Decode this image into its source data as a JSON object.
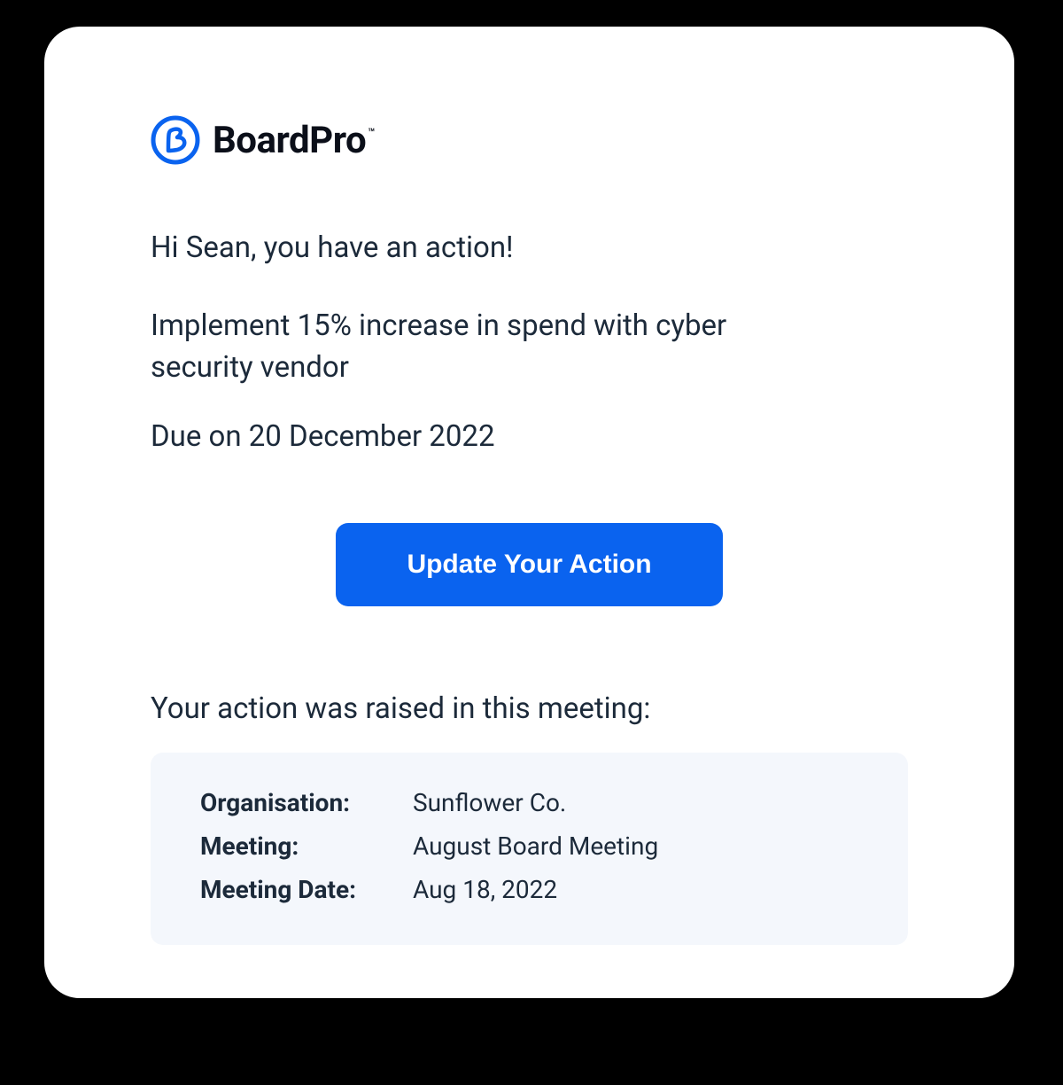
{
  "brand": {
    "name": "BoardPro",
    "tm": "™",
    "accent_color": "#0a63ef"
  },
  "greeting": "Hi Sean, you have an action!",
  "action_description": "Implement 15% increase in spend with cyber security vendor",
  "due_text": "Due on 20 December 2022",
  "cta_label": "Update Your Action",
  "meeting_intro": "Your action was raised in this meeting:",
  "meeting": {
    "labels": {
      "organisation": "Organisation:",
      "meeting": "Meeting:",
      "meeting_date": "Meeting Date:"
    },
    "values": {
      "organisation": "Sunflower Co.",
      "meeting": "August Board Meeting",
      "meeting_date": "Aug 18, 2022"
    }
  }
}
